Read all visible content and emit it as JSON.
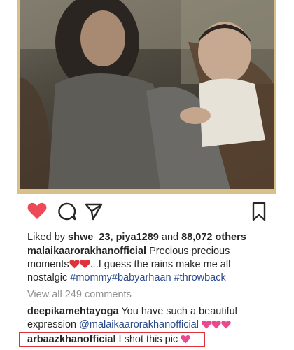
{
  "post": {
    "liked_by_prefix": "Liked by",
    "liked_user1": "shwe_23",
    "liked_sep": ",",
    "liked_user2": "piya1289",
    "liked_and": "and",
    "likes_count": "88,072 others",
    "author": "malaikaarorakhanofficial",
    "caption_1": "Precious precious",
    "caption_2a": "moments",
    "caption_2b": "...I guess the rains make me all",
    "caption_3a": "nostalgic",
    "hashtags": [
      "#mommy",
      "#babyarhaan",
      "#throwback"
    ],
    "view_comments": "View all 249 comments"
  },
  "comments": [
    {
      "user": "deepikamehtayoga",
      "text_1": "You have such a beautiful",
      "text_2": "expression",
      "mention": "@malaikaarorakhanofficial"
    },
    {
      "user": "arbaazkhanofficial",
      "text": "I shot this pic"
    }
  ],
  "icons": {
    "like": "heart-icon",
    "comment": "comment-bubble-icon",
    "share": "paper-plane-icon",
    "save": "bookmark-icon"
  },
  "colors": {
    "like_red": "#ed4956",
    "heart_emoji": "#e0323a",
    "pink_heart": "#e94a8f",
    "hashtag_blue": "#2b4a8b",
    "highlight_border": "#e0323a"
  }
}
